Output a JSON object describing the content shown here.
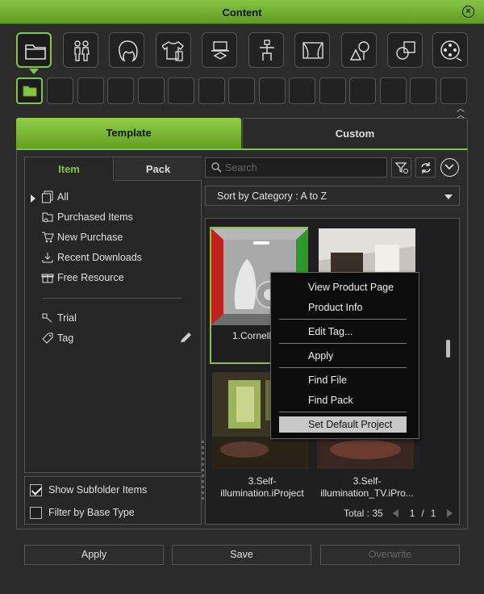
{
  "window": {
    "title": "Content",
    "close_icon": "close-circle-icon"
  },
  "categories": [
    {
      "name": "folder-icon",
      "active": true
    },
    {
      "name": "avatar-pair-icon"
    },
    {
      "name": "hair-icon"
    },
    {
      "name": "clothing-icon"
    },
    {
      "name": "stage-prop-icon"
    },
    {
      "name": "motion-figure-icon"
    },
    {
      "name": "stage-curtain-icon"
    },
    {
      "name": "tree-set-icon"
    },
    {
      "name": "shapes-icon"
    },
    {
      "name": "film-reel-icon"
    }
  ],
  "main_tabs": {
    "template": "Template",
    "custom": "Custom"
  },
  "library_tabs": {
    "item": "Item",
    "pack": "Pack"
  },
  "tree": {
    "all": "All",
    "purchased": "Purchased Items",
    "new_purchase": "New Purchase",
    "recent_downloads": "Recent Downloads",
    "free_resource": "Free Resource",
    "trial": "Trial",
    "tag": "Tag"
  },
  "filters": {
    "show_subfolder": "Show Subfolder Items",
    "show_subfolder_checked": true,
    "filter_base": "Filter by Base Type",
    "filter_base_checked": false
  },
  "search": {
    "placeholder": "Search"
  },
  "sort": {
    "label": "Sort by Category : A to Z"
  },
  "tiles": [
    {
      "caption": "1.Cornell Box",
      "selected": true
    },
    {
      "caption": ""
    },
    {
      "caption_line1": "3.Self-",
      "caption_line2": "illumination.iProject"
    },
    {
      "caption_line1": "3.Self-",
      "caption_line2": "illumination_TV.iPro..."
    }
  ],
  "pager": {
    "total_label": "Total : 35",
    "page": "1",
    "separator": "/",
    "pages": "1"
  },
  "context_menu": {
    "view_product_page": "View Product Page",
    "product_info": "Product Info",
    "edit_tag": "Edit Tag...",
    "apply": "Apply",
    "find_file": "Find File",
    "find_pack": "Find Pack",
    "set_default_project": "Set Default Project"
  },
  "buttons": {
    "apply": "Apply",
    "save": "Save",
    "overwrite": "Overwrite"
  },
  "colors": {
    "accent": "#86c443",
    "bg": "#2b2b2b",
    "panel": "#262626"
  }
}
